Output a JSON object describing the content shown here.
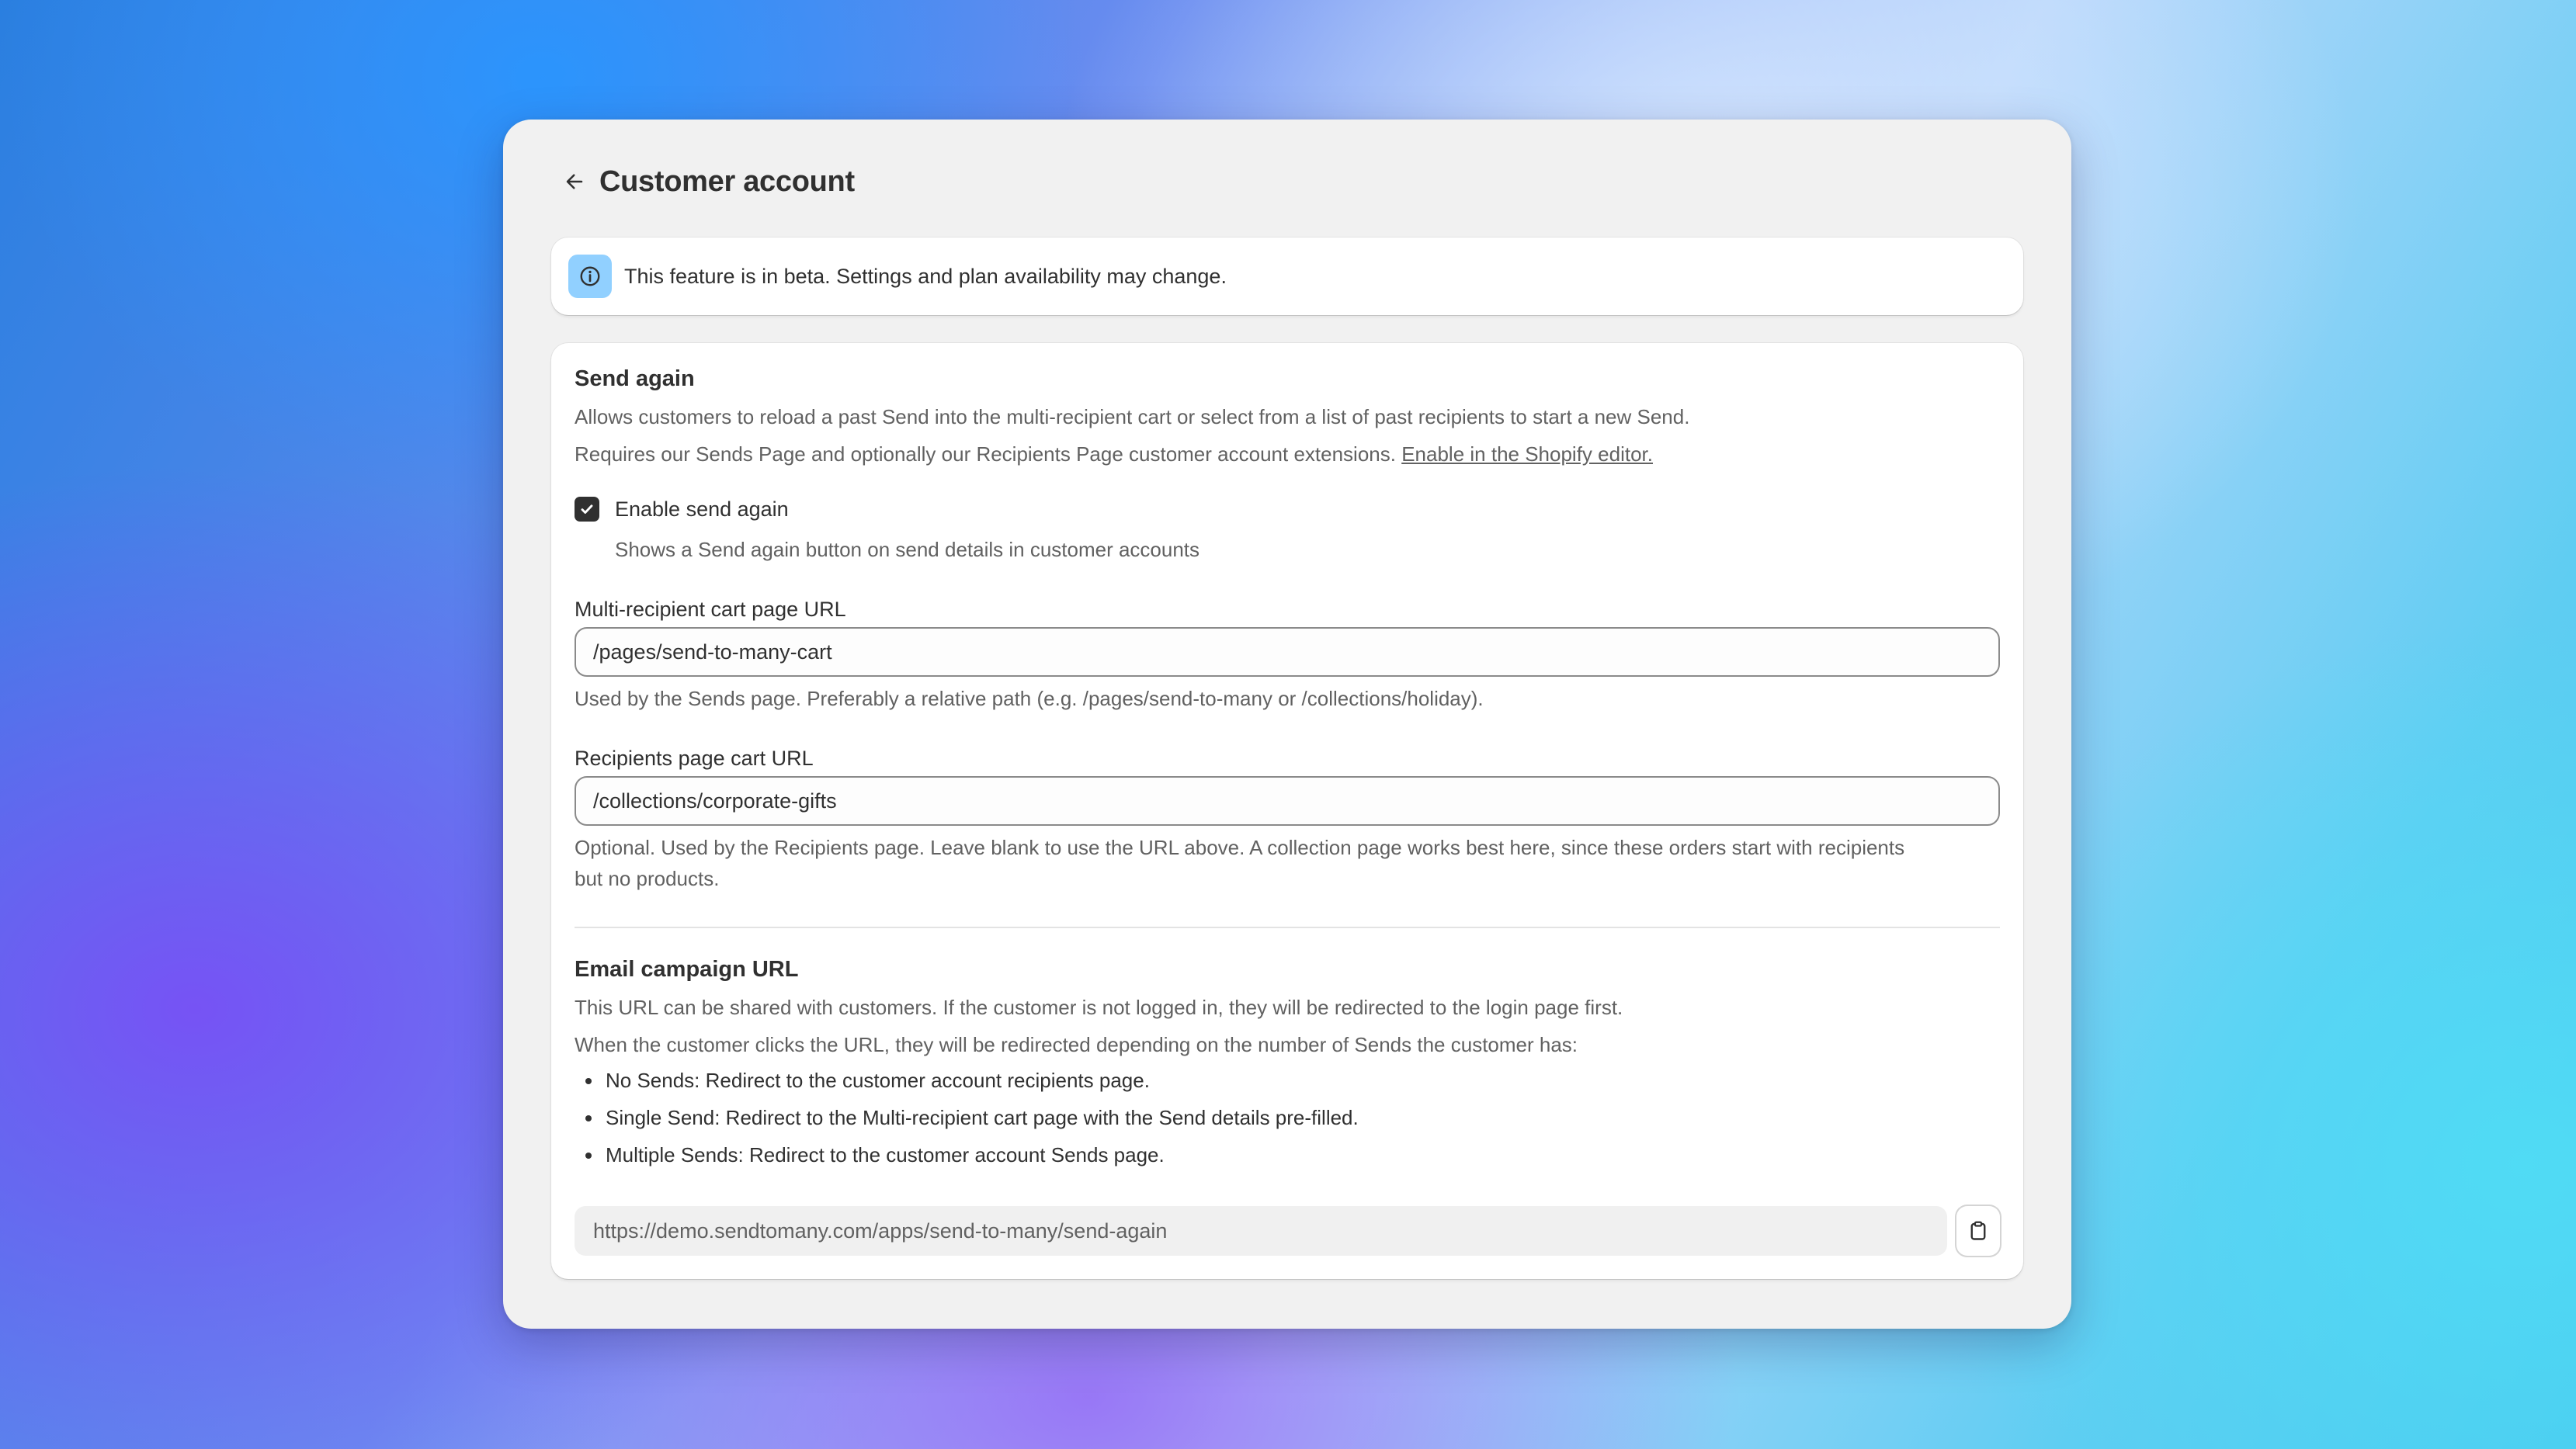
{
  "header": {
    "title": "Customer account"
  },
  "banner": {
    "text": "This feature is in beta. Settings and plan availability may change."
  },
  "send_again": {
    "title": "Send again",
    "description": "Allows customers to reload a past Send into the multi-recipient cart or select from a list of past recipients to start a new Send.",
    "requirement": "Requires our Sends Page and optionally our Recipients Page customer account extensions.",
    "editor_link": "Enable in the Shopify editor.",
    "checkbox_label": "Enable send again",
    "checkbox_checked": true,
    "checkbox_help": "Shows a Send again button on send details in customer accounts",
    "cart_url_label": "Multi-recipient cart page URL",
    "cart_url_value": "/pages/send-to-many-cart",
    "cart_url_help": "Used by the Sends page. Preferably a relative path (e.g. /pages/send-to-many or /collections/holiday).",
    "recipients_url_label": "Recipients page cart URL",
    "recipients_url_value": "/collections/corporate-gifts",
    "recipients_url_help_line1": "Optional. Used by the Recipients page. Leave blank to use the URL above. A collection page works best here, since these orders start with recipients",
    "recipients_url_help_line2": "but no products."
  },
  "email_campaign": {
    "title": "Email campaign URL",
    "line1": "This URL can be shared with customers. If the customer is not logged in, they will be redirected to the login page first.",
    "line2": "When the customer clicks the URL, they will be redirected depending on the number of Sends the customer has:",
    "bullets": [
      "No Sends: Redirect to the customer account recipients page.",
      "Single Send: Redirect to the Multi-recipient cart page with the Send details pre-filled.",
      "Multiple Sends: Redirect to the customer account Sends page."
    ],
    "url_value": "https://demo.sendtomany.com/apps/send-to-many/send-again"
  },
  "icons": {
    "back": "arrow-left-icon",
    "info": "info-icon",
    "checkmark": "checkmark-icon",
    "copy": "clipboard-icon"
  },
  "colors": {
    "accent_info": "#91d0ff",
    "text_primary": "#303030",
    "text_secondary": "#616161",
    "window_bg": "#f1f1f1"
  }
}
